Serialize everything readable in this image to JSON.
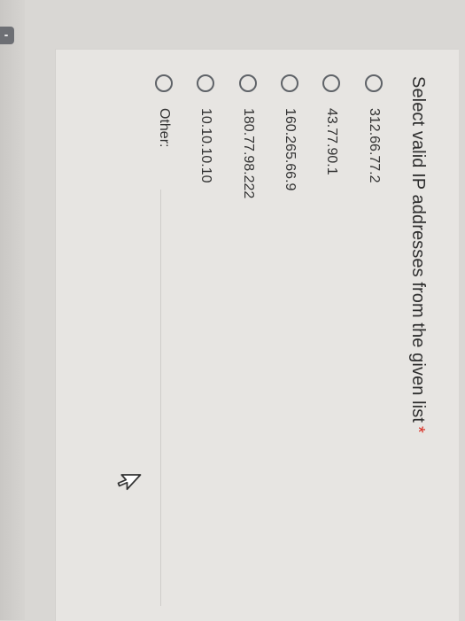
{
  "question": {
    "text": "Select valid IP addresses from the given list",
    "required_marker": "*"
  },
  "options": [
    {
      "label": "312.66.77.2",
      "selected": false
    },
    {
      "label": "43.77.90.1",
      "selected": false
    },
    {
      "label": "160.265.66.9",
      "selected": false
    },
    {
      "label": "180.77.98.222",
      "selected": false
    },
    {
      "label": "10.10.10.10",
      "selected": false
    },
    {
      "label": "Other:",
      "selected": false
    }
  ],
  "colors": {
    "required": "#d93025",
    "radio_border": "#5f6368",
    "card": "#e7e5e2"
  }
}
